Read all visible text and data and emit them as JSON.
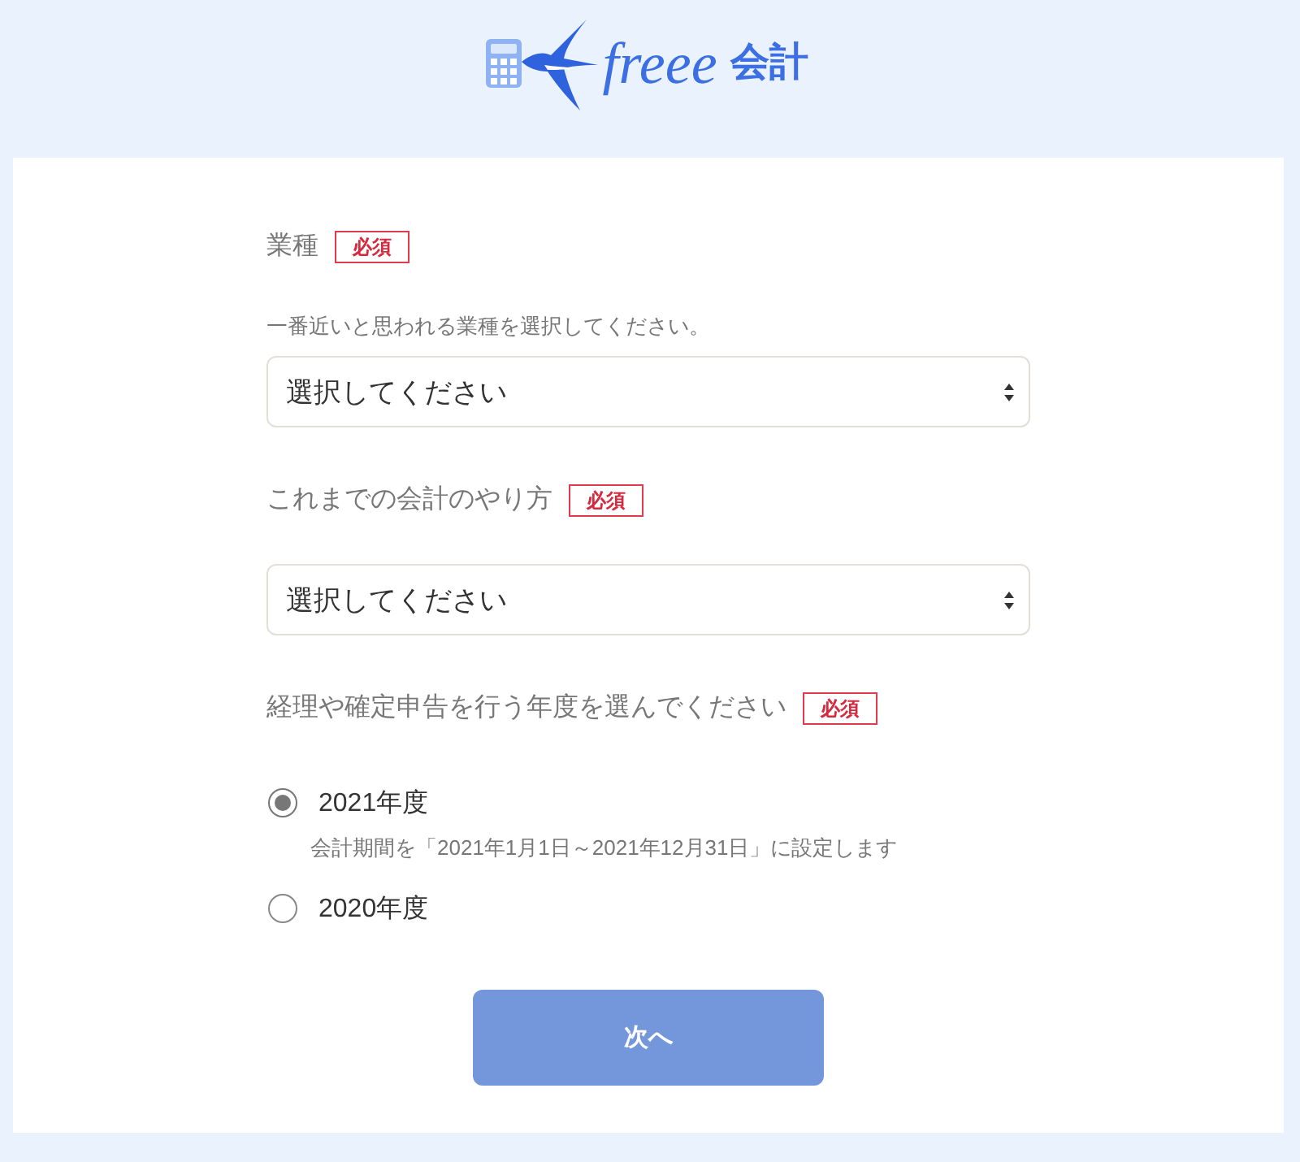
{
  "header": {
    "logo": {
      "wordmark": "freee",
      "product": "会計"
    }
  },
  "form": {
    "fields": [
      {
        "kind": "select",
        "label": "業種",
        "badge": "必須",
        "hint": "一番近いと思われる業種を選択してください。",
        "value": "選択してください"
      },
      {
        "kind": "select",
        "label": "これまでの会計のやり方",
        "badge": "必須",
        "value": "選択してください"
      },
      {
        "kind": "radio",
        "label": "経理や確定申告を行う年度を選んでください",
        "badge": "必須",
        "options": [
          {
            "label": "2021年度",
            "selected": true,
            "note": "会計期間を「2021年1月1日～2021年12月31日」に設定します"
          },
          {
            "label": "2020年度",
            "selected": false
          }
        ]
      }
    ],
    "submit": {
      "label": "次へ",
      "disabled": true
    }
  }
}
